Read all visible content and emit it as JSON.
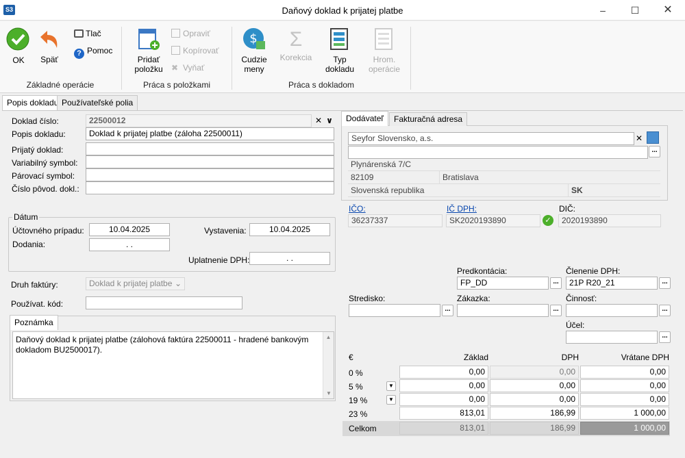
{
  "window": {
    "title": "Daňový doklad k prijatej platbe",
    "app_logo": "S3"
  },
  "ribbon": {
    "ok": "OK",
    "back": "Späť",
    "print": "Tlač",
    "help": "Pomoc",
    "group_basic": "Základné operácie",
    "add_item_1": "Pridať",
    "add_item_2": "položku",
    "edit": "Opraviť",
    "copy": "Kopírovať",
    "cut": "Vyňať",
    "group_items": "Práca s položkami",
    "currency_1": "Cudzie",
    "currency_2": "meny",
    "correction": "Korekcia",
    "doctype_1": "Typ",
    "doctype_2": "dokladu",
    "bulk_1": "Hrom.",
    "bulk_2": "operácie",
    "group_doc": "Práca s dokladom"
  },
  "tabs": {
    "main": "Popis dokladu",
    "user": "Používateľské polia"
  },
  "doc": {
    "number_label": "Doklad číslo:",
    "number": "22500012",
    "desc_label": "Popis dokladu:",
    "desc": "Doklad k prijatej platbe (záloha 22500011)",
    "received_label": "Prijatý doklad:",
    "received": "",
    "vs_label": "Variabilný symbol:",
    "vs": "",
    "pair_label": "Párovací symbol:",
    "pair": "",
    "orig_label": "Číslo pôvod. dokl.:",
    "orig": ""
  },
  "dates": {
    "group": "Dátum",
    "acc_label": "Účtovného prípadu:",
    "acc": "10.04.2025",
    "issue_label": "Vystavenia:",
    "issue": "10.04.2025",
    "delivery_label": "Dodania:",
    "delivery": ". .",
    "vat_label": "Uplatnenie DPH:",
    "vat": ". ."
  },
  "invoice": {
    "type_label": "Druh faktúry:",
    "type": "Doklad k prijatej platbe",
    "user_code_label": "Používat. kód:",
    "user_code": ""
  },
  "note": {
    "tab": "Poznámka",
    "text": "Daňový doklad k prijatej platbe (zálohová faktúra 22500011 - hradené bankovým dokladom BU2500017)."
  },
  "supplier": {
    "tab": "Dodávateľ",
    "tab2": "Fakturačná adresa",
    "name": "Seyfor Slovensko, a.s.",
    "street": "Plynárenská 7/C",
    "zip": "82109",
    "city": "Bratislava",
    "country": "Slovenská republika",
    "country_code": "SK",
    "ico_label": "IČO:",
    "ico": "36237337",
    "icdph_label": "IČ DPH:",
    "icdph": "SK2020193890",
    "dic_label": "DIČ:",
    "dic": "2020193890"
  },
  "accounting": {
    "predkontacia_label": "Predkontácia:",
    "predkontacia": "FP_DD",
    "clenenie_label": "Členenie DPH:",
    "clenenie": "21P R20_21",
    "stredisko_label": "Stredisko:",
    "stredisko": "",
    "zakazka_label": "Zákazka:",
    "zakazka": "",
    "cinnost_label": "Činnosť:",
    "cinnost": "",
    "ucel_label": "Účel:",
    "ucel": ""
  },
  "vat": {
    "currency": "€",
    "col_base": "Základ",
    "col_vat": "DPH",
    "col_total": "Vrátane DPH",
    "rows": [
      {
        "rate": "0 %",
        "base": "0,00",
        "vat": "0,00",
        "total": "0,00"
      },
      {
        "rate": "5 %",
        "base": "0,00",
        "vat": "0,00",
        "total": "0,00"
      },
      {
        "rate": "19 %",
        "base": "0,00",
        "vat": "0,00",
        "total": "0,00"
      },
      {
        "rate": "23 %",
        "base": "813,01",
        "vat": "186,99",
        "total": "1 000,00"
      }
    ],
    "sum_label": "Celkom",
    "sum_base": "813,01",
    "sum_vat": "186,99",
    "sum_total": "1 000,00"
  }
}
